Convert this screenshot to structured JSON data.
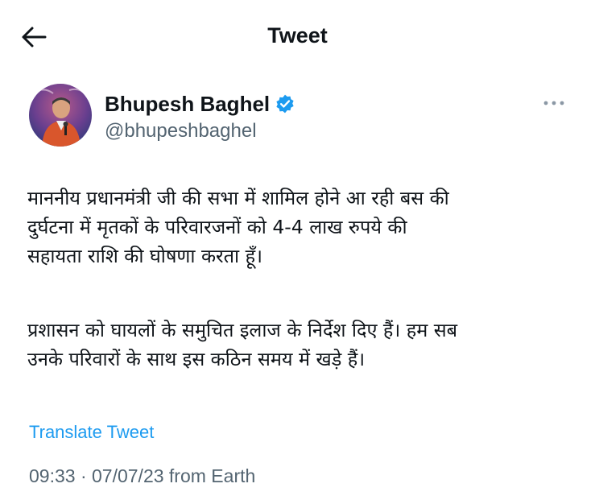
{
  "header": {
    "title": "Tweet",
    "back_icon": "arrow-left-icon"
  },
  "author": {
    "display_name": "Bhupesh Baghel",
    "handle": "@bhupeshbaghel",
    "verified": true,
    "verified_color": "#1d9bf0",
    "more_icon": "more-horizontal-icon"
  },
  "tweet": {
    "lines_p1": [
      "माननीय प्रधानमंत्री जी की सभा में शामिल होने आ रही बस की",
      "दुर्घटना में मृतकों के परिवारजनों को 4-4 लाख रुपये की",
      "सहायता राशि की घोषणा करता हूँ।"
    ],
    "lines_p2": [
      "प्रशासन को घायलों के समुचित इलाज के निर्देश दिए हैं। हम सब",
      "उनके परिवारों के साथ इस कठिन समय में खड़े हैं।"
    ],
    "translate_label": "Translate Tweet",
    "meta": "09:33 · 07/07/23 from Earth"
  },
  "colors": {
    "text": "#0f1419",
    "secondary": "#536471",
    "link": "#1d9bf0"
  }
}
